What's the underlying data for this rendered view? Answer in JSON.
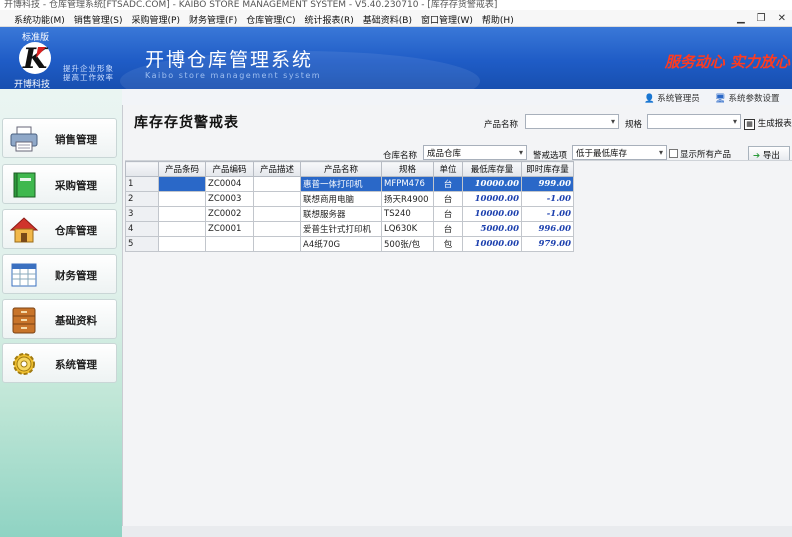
{
  "window": {
    "title": "开博科技 - 仓库管理系统[FTSADC.COM] - KAIBO STORE MANAGEMENT SYSTEM - V5.40.230710 - [库存存货警戒表]"
  },
  "menu": [
    "系统功能(M)",
    "销售管理(S)",
    "采购管理(P)",
    "财务管理(F)",
    "仓库管理(C)",
    "统计报表(R)",
    "基础资料(B)",
    "窗口管理(W)",
    "帮助(H)"
  ],
  "banner": {
    "edition": "标准版",
    "logo_letter": "K",
    "logo_caption": "开博科技",
    "slogan_line1": "提升企业形象",
    "slogan_line2": "提高工作效率",
    "app_title": "开博仓库管理系统",
    "app_subtitle": "Kaibo store management system",
    "motto": "服务动心  实力放心"
  },
  "sidebar": [
    {
      "label": "销售管理",
      "icon": "printer-icon"
    },
    {
      "label": "采购管理",
      "icon": "book-icon"
    },
    {
      "label": "仓库管理",
      "icon": "house-icon"
    },
    {
      "label": "财务管理",
      "icon": "spreadsheet-icon"
    },
    {
      "label": "基础资料",
      "icon": "cabinet-icon"
    },
    {
      "label": "系统管理",
      "icon": "gear-icon"
    }
  ],
  "toolbar": {
    "admin": "系统管理员",
    "settings": "系统参数设置"
  },
  "report": {
    "title": "库存存货警戒表",
    "product_name_label": "产品名称",
    "product_name_value": "",
    "spec_label": "规格",
    "spec_value": "",
    "generate_button": "生成报表",
    "warehouse_label": "仓库名称",
    "warehouse_value": "成品仓库",
    "alert_label": "警戒选项",
    "alert_value": "低于最低库存",
    "show_all_label": "显示所有产品",
    "export_button": "导出"
  },
  "table": {
    "columns": [
      "",
      "产品条码",
      "产品编码",
      "产品描述",
      "产品名称",
      "规格",
      "单位",
      "最低库存量",
      "即时库存量"
    ],
    "rows": [
      {
        "n": "1",
        "barcode": "",
        "code": "ZC0004",
        "desc": "",
        "name": "惠普一体打印机",
        "spec": "MFPM476",
        "unit": "台",
        "min": "10000.00",
        "cur": "999.00"
      },
      {
        "n": "2",
        "barcode": "",
        "code": "ZC0003",
        "desc": "",
        "name": "联想商用电脑",
        "spec": "扬天R4900",
        "unit": "台",
        "min": "10000.00",
        "cur": "-1.00"
      },
      {
        "n": "3",
        "barcode": "",
        "code": "ZC0002",
        "desc": "",
        "name": "联想服务器",
        "spec": "TS240",
        "unit": "台",
        "min": "10000.00",
        "cur": "-1.00"
      },
      {
        "n": "4",
        "barcode": "",
        "code": "ZC0001",
        "desc": "",
        "name": "爱普生针式打印机",
        "spec": "LQ630K",
        "unit": "台",
        "min": "5000.00",
        "cur": "996.00"
      },
      {
        "n": "5",
        "barcode": "",
        "code": "",
        "desc": "",
        "name": "A4纸70G",
        "spec": "500张/包",
        "unit": "包",
        "min": "10000.00",
        "cur": "979.00"
      }
    ]
  },
  "colors": {
    "banner_blue": "#1f5cc6",
    "motto_red": "#ff3b1f",
    "selection_blue": "#2a68c8",
    "value_blue": "#1b3fae"
  }
}
